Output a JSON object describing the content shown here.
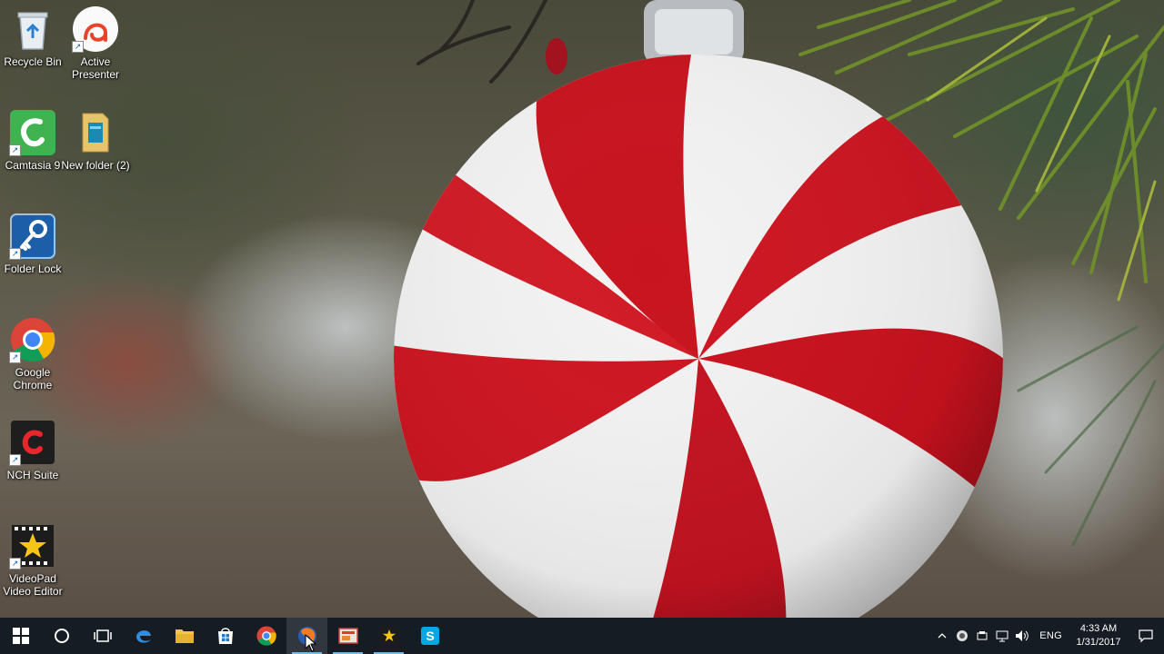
{
  "desktop": {
    "icons": [
      {
        "label": "Recycle Bin",
        "icon": "recycle-bin-icon"
      },
      {
        "label": "Active Presenter",
        "icon": "active-presenter-icon"
      },
      {
        "label": "Camtasia 9",
        "icon": "camtasia-icon"
      },
      {
        "label": "New folder (2)",
        "icon": "folder-icon"
      },
      {
        "label": "Folder Lock",
        "icon": "folder-lock-icon"
      },
      {
        "label": "Google Chrome",
        "icon": "chrome-icon"
      },
      {
        "label": "NCH Suite",
        "icon": "nch-suite-icon"
      },
      {
        "label": "VideoPad Video Editor",
        "icon": "videopad-icon"
      }
    ]
  },
  "taskbar": {
    "buttons": [
      {
        "name": "start-button",
        "icon": "windows-logo-icon"
      },
      {
        "name": "cortana-search-button",
        "icon": "circle-icon"
      },
      {
        "name": "task-view-button",
        "icon": "task-view-icon"
      },
      {
        "name": "edge-button",
        "icon": "edge-icon"
      },
      {
        "name": "file-explorer-button",
        "icon": "folder-icon"
      },
      {
        "name": "store-button",
        "icon": "store-icon"
      },
      {
        "name": "chrome-taskbar-button",
        "icon": "chrome-icon"
      },
      {
        "name": "firefox-taskbar-button",
        "icon": "firefox-icon"
      },
      {
        "name": "presentation-app-button",
        "icon": "presenter-icon"
      },
      {
        "name": "videopad-taskbar-button",
        "icon": "videopad-icon"
      },
      {
        "name": "skype-button",
        "icon": "skype-icon"
      }
    ],
    "tray": {
      "language": "ENG",
      "time": "4:33 AM",
      "date": "1/31/2017"
    }
  },
  "colors": {
    "taskbar": "#151c24",
    "accent": "#76b9ed"
  }
}
